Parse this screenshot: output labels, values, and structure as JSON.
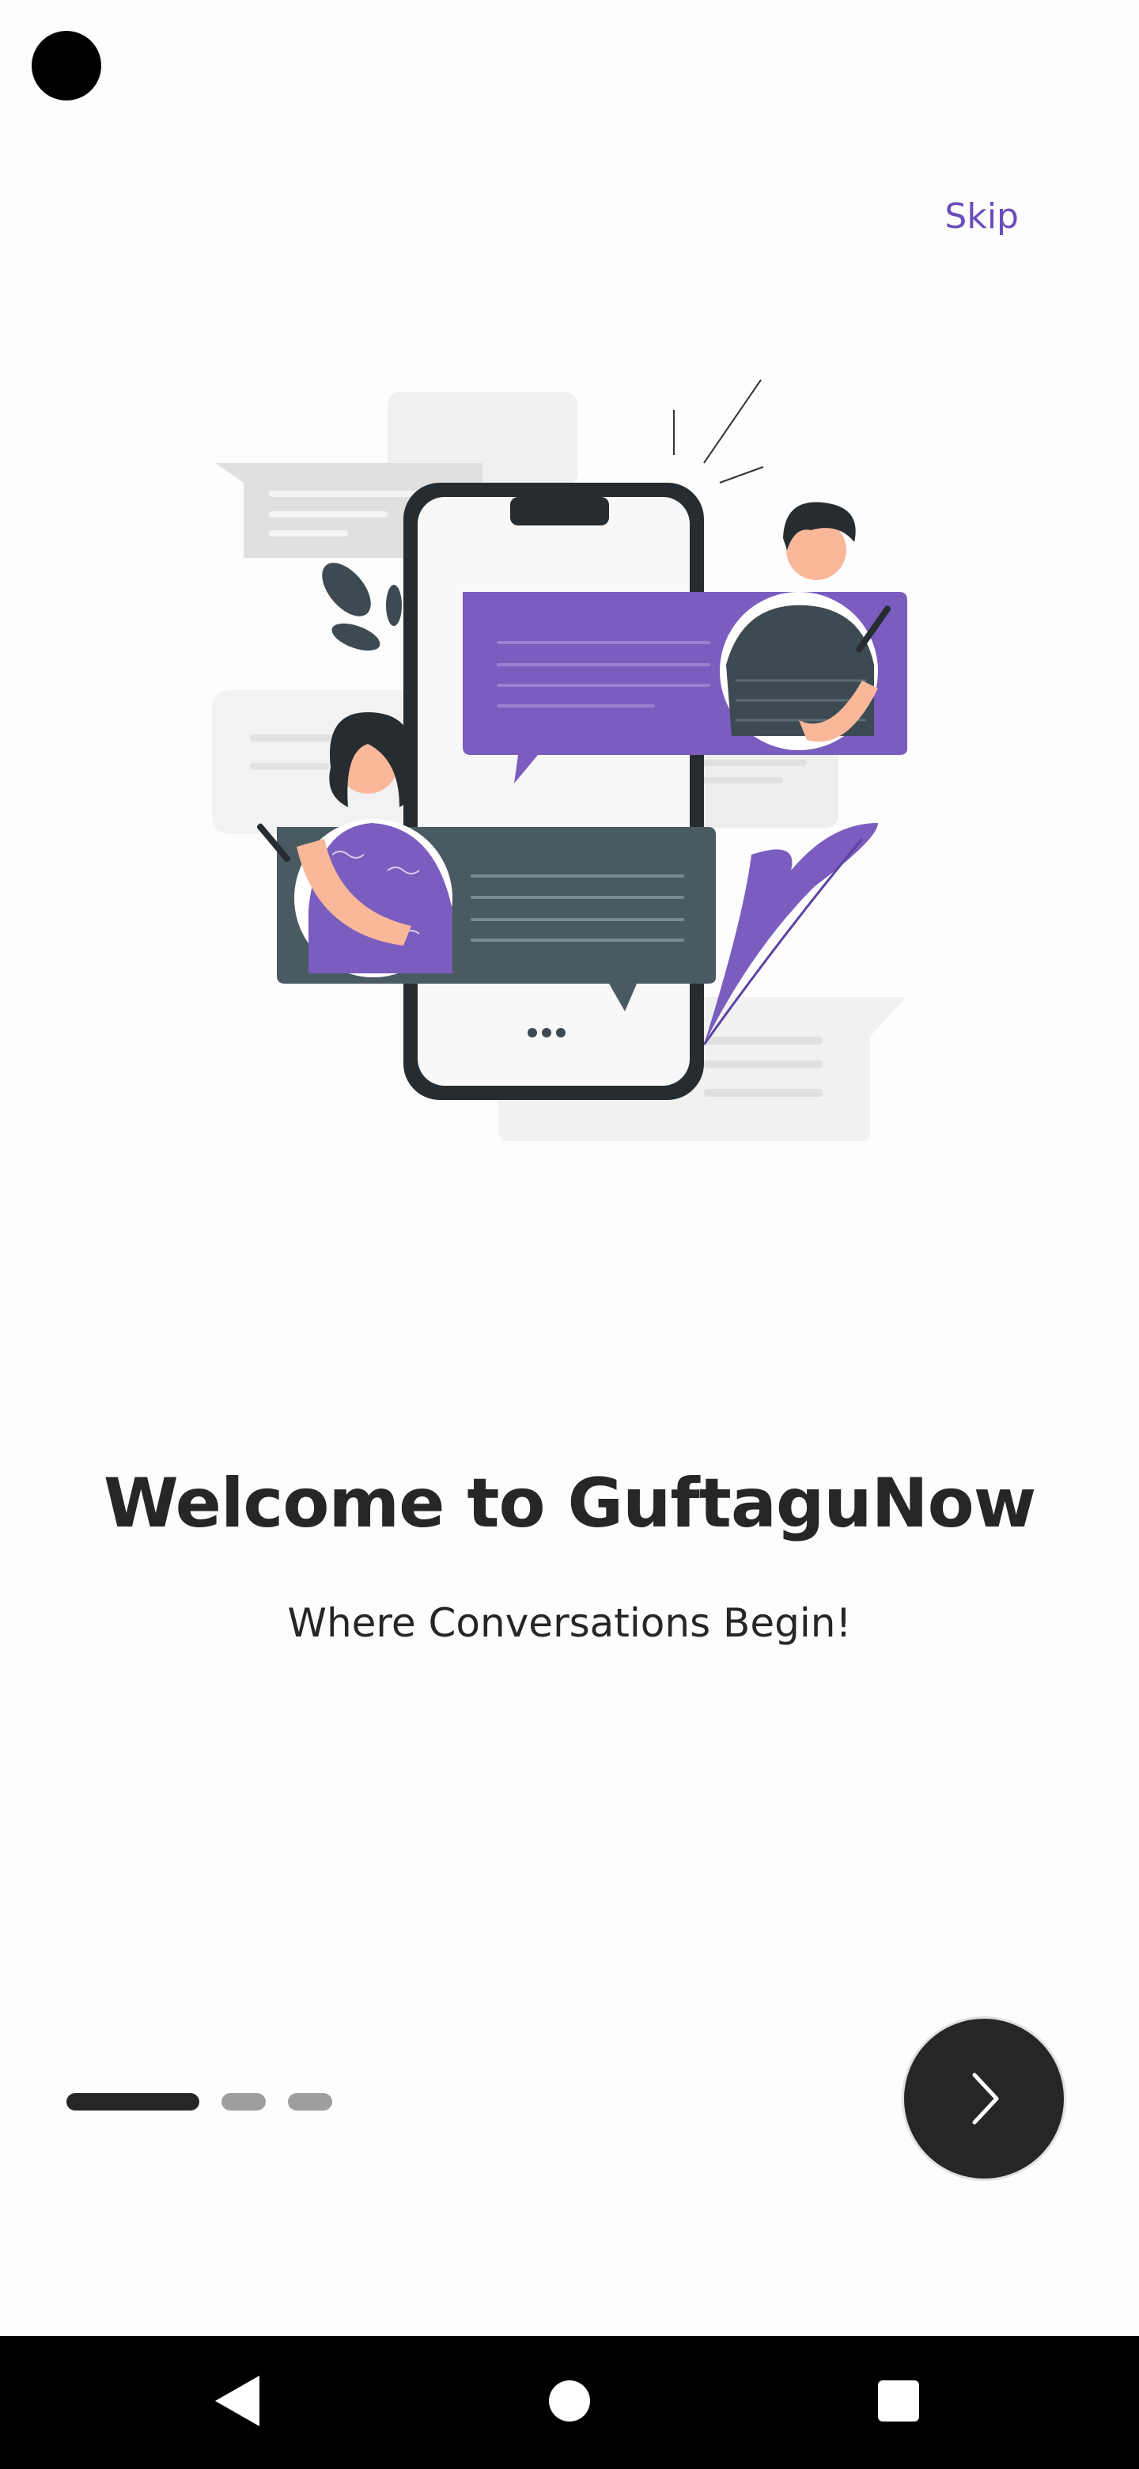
{
  "header": {
    "skip_label": "Skip"
  },
  "onboarding": {
    "title": "Welcome to GuftaguNow",
    "subtitle": "Where Conversations Begin!",
    "current_page": 1,
    "total_pages": 3
  },
  "icons": {
    "next": "chevron-right-icon",
    "nav_back": "back-triangle-icon",
    "nav_home": "home-circle-icon",
    "nav_recent": "recent-apps-square-icon"
  },
  "colors": {
    "accent": "#6c4cbc",
    "purple_bubble": "#7b5cbf",
    "dark": "#262626",
    "slate": "#4a5a63"
  }
}
